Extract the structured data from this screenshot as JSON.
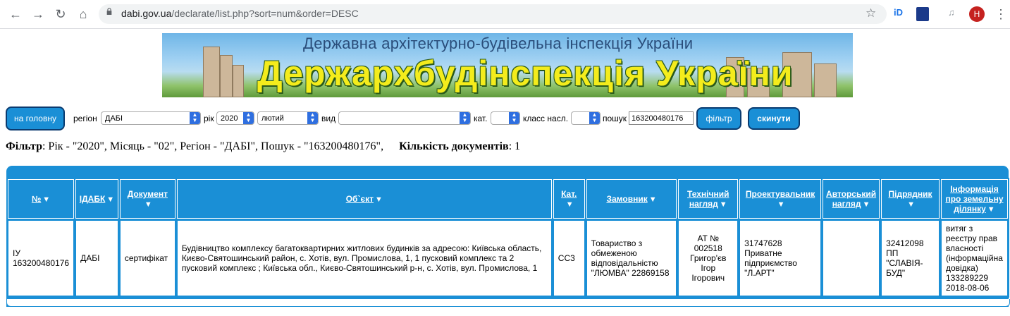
{
  "browser": {
    "url_host": "dabi.gov.ua",
    "url_path": "/declarate/list.php?sort=num&order=DESC",
    "avatar_letter": "H",
    "ext_label": "iD"
  },
  "banner": {
    "subtitle": "Державна архітектурно-будівельна інспекція України",
    "title": "Держархбудінспекція України"
  },
  "filters": {
    "home_button": "на головну",
    "region_label": "регіон",
    "region_value": "ДАБІ",
    "year_label": "рік",
    "year_value": "2020",
    "month_value": "лютий",
    "type_label": "вид",
    "type_value": "",
    "category_label": "кат.",
    "category_value": "",
    "class_label": "класс насл.",
    "class_value": "",
    "search_label": "пошук",
    "search_value": "163200480176",
    "filter_button": "фільтр",
    "reset_button": "скинути"
  },
  "summary": {
    "filter_label": "Фільтр",
    "filter_text": ": Рік - \"2020\", Місяць - \"02\", Регіон - \"ДАБІ\", Пошук - \"163200480176\",",
    "count_label": "Кількість документів",
    "count_value": ": 1"
  },
  "table": {
    "headers": {
      "num": "№",
      "idabk": "ІДАБК",
      "document": "Документ",
      "object": "Об`єкт",
      "category": "Кат.",
      "customer": "Замовник",
      "tech_line1": "Технічний",
      "tech_line2": "нагляд",
      "designer": "Проектувальник",
      "author_line1": "Авторський",
      "author_line2": "нагляд",
      "contractor": "Підрядник",
      "land_line1": "Інформація",
      "land_line2": "про земельну",
      "land_line3": "ділянку"
    },
    "row": {
      "num_line1": "ІУ",
      "num_line2": "163200480176",
      "idabk": "ДАБІ",
      "document": "сертифікат",
      "object": "Будівництво комплексу багатоквартирних житлових будинків за адресою: Київська область, Києво-Святошинський район, с. Хотів, вул. Промислова, 1, 1 пусковий комплекс та 2 пусковий комплекс ; Київська обл., Києво-Святошинський р-н, с. Хотів, вул. Промислова, 1",
      "category": "СС3",
      "customer": "Товариство з обмеженою відповідальністю \"ЛЮМВА\" 22869158",
      "tech_line1": "АТ № 002518",
      "tech_line2": "Григор'єв",
      "tech_line3": "Ігор",
      "tech_line4": "Ігорович",
      "designer": "31747628 Приватне підприємство \"Л.АРТ\"",
      "author": "",
      "contractor": "32412098 ПП \"СЛАВІЯ-БУД\"",
      "land": "витяг з реєстру прав власності (інформаційна довідка) 133289229 2018-08-06"
    }
  }
}
